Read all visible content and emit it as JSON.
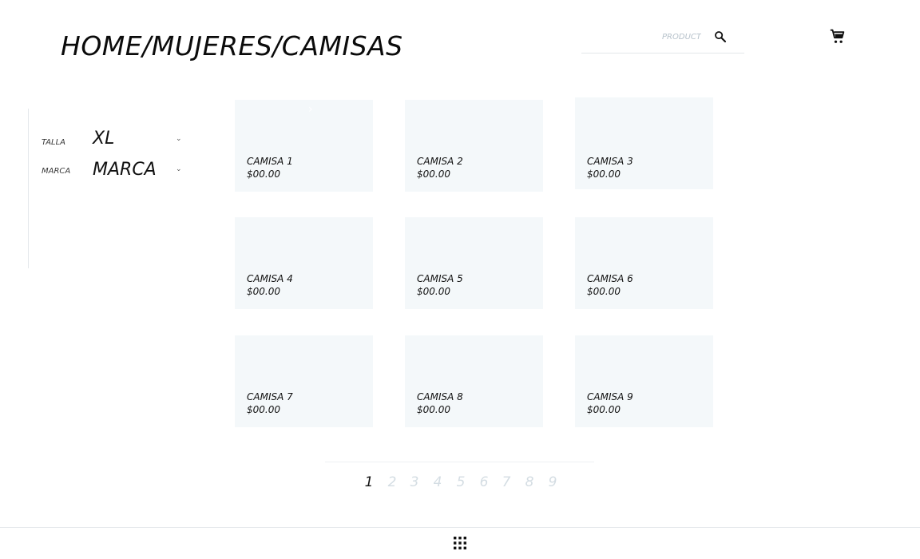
{
  "header": {
    "breadcrumb": "HOME/MUJERES/CAMISAS",
    "search": {
      "placeholder": "PRODUCT",
      "value": ""
    },
    "icons": {
      "search": "search-icon",
      "cart": "cart-icon"
    }
  },
  "filters": [
    {
      "label": "TALLA",
      "value": "XL",
      "icon": "chevron-down-icon"
    },
    {
      "label": "MARCA",
      "value": "MARCA",
      "icon": "chevron-down-icon"
    }
  ],
  "products": [
    {
      "name": "CAMISA 1",
      "price": "$00.00"
    },
    {
      "name": "CAMISA 2",
      "price": "$00.00"
    },
    {
      "name": "CAMISA 3",
      "price": "$00.00"
    },
    {
      "name": "CAMISA 4",
      "price": "$00.00"
    },
    {
      "name": "CAMISA 5",
      "price": "$00.00"
    },
    {
      "name": "CAMISA 6",
      "price": "$00.00"
    },
    {
      "name": "CAMISA 7",
      "price": "$00.00"
    },
    {
      "name": "CAMISA 8",
      "price": "$00.00"
    },
    {
      "name": "CAMISA 9",
      "price": "$00.00"
    }
  ],
  "pagination": {
    "pages": [
      "1",
      "2",
      "3",
      "4",
      "5",
      "6",
      "7",
      "8",
      "9"
    ],
    "current": "1"
  },
  "footer": {
    "icon": "grid-menu-icon"
  },
  "colors": {
    "card_bg": "#f4f8fa",
    "inactive_page": "#d4dde3",
    "text": "#111111"
  }
}
